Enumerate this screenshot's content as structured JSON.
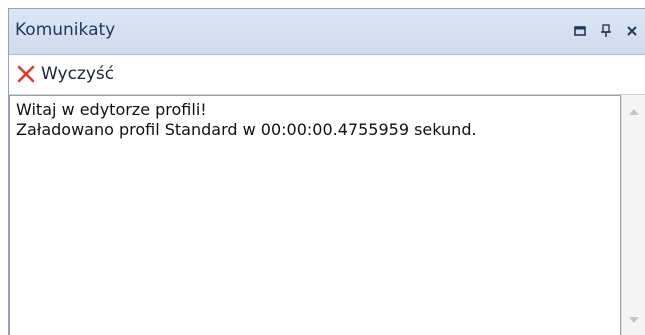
{
  "panel": {
    "title": "Komunikaty",
    "buttons": [
      {
        "name": "restore-window-button",
        "icon": "restore-window-icon"
      },
      {
        "name": "pin-button",
        "icon": "pin-icon"
      },
      {
        "name": "close-button",
        "icon": "close-icon"
      }
    ]
  },
  "toolbar": {
    "clear_label": "Wyczyść",
    "clear_icon": "red-x-icon"
  },
  "log": {
    "lines": [
      "Witaj w edytorze profili!",
      "Załadowano profil Standard w 00:00:00.4755959 sekund."
    ]
  },
  "colors": {
    "title_bar": "#dbe6f5",
    "clear_icon_red": "#e03a2e",
    "text": "#111111"
  }
}
